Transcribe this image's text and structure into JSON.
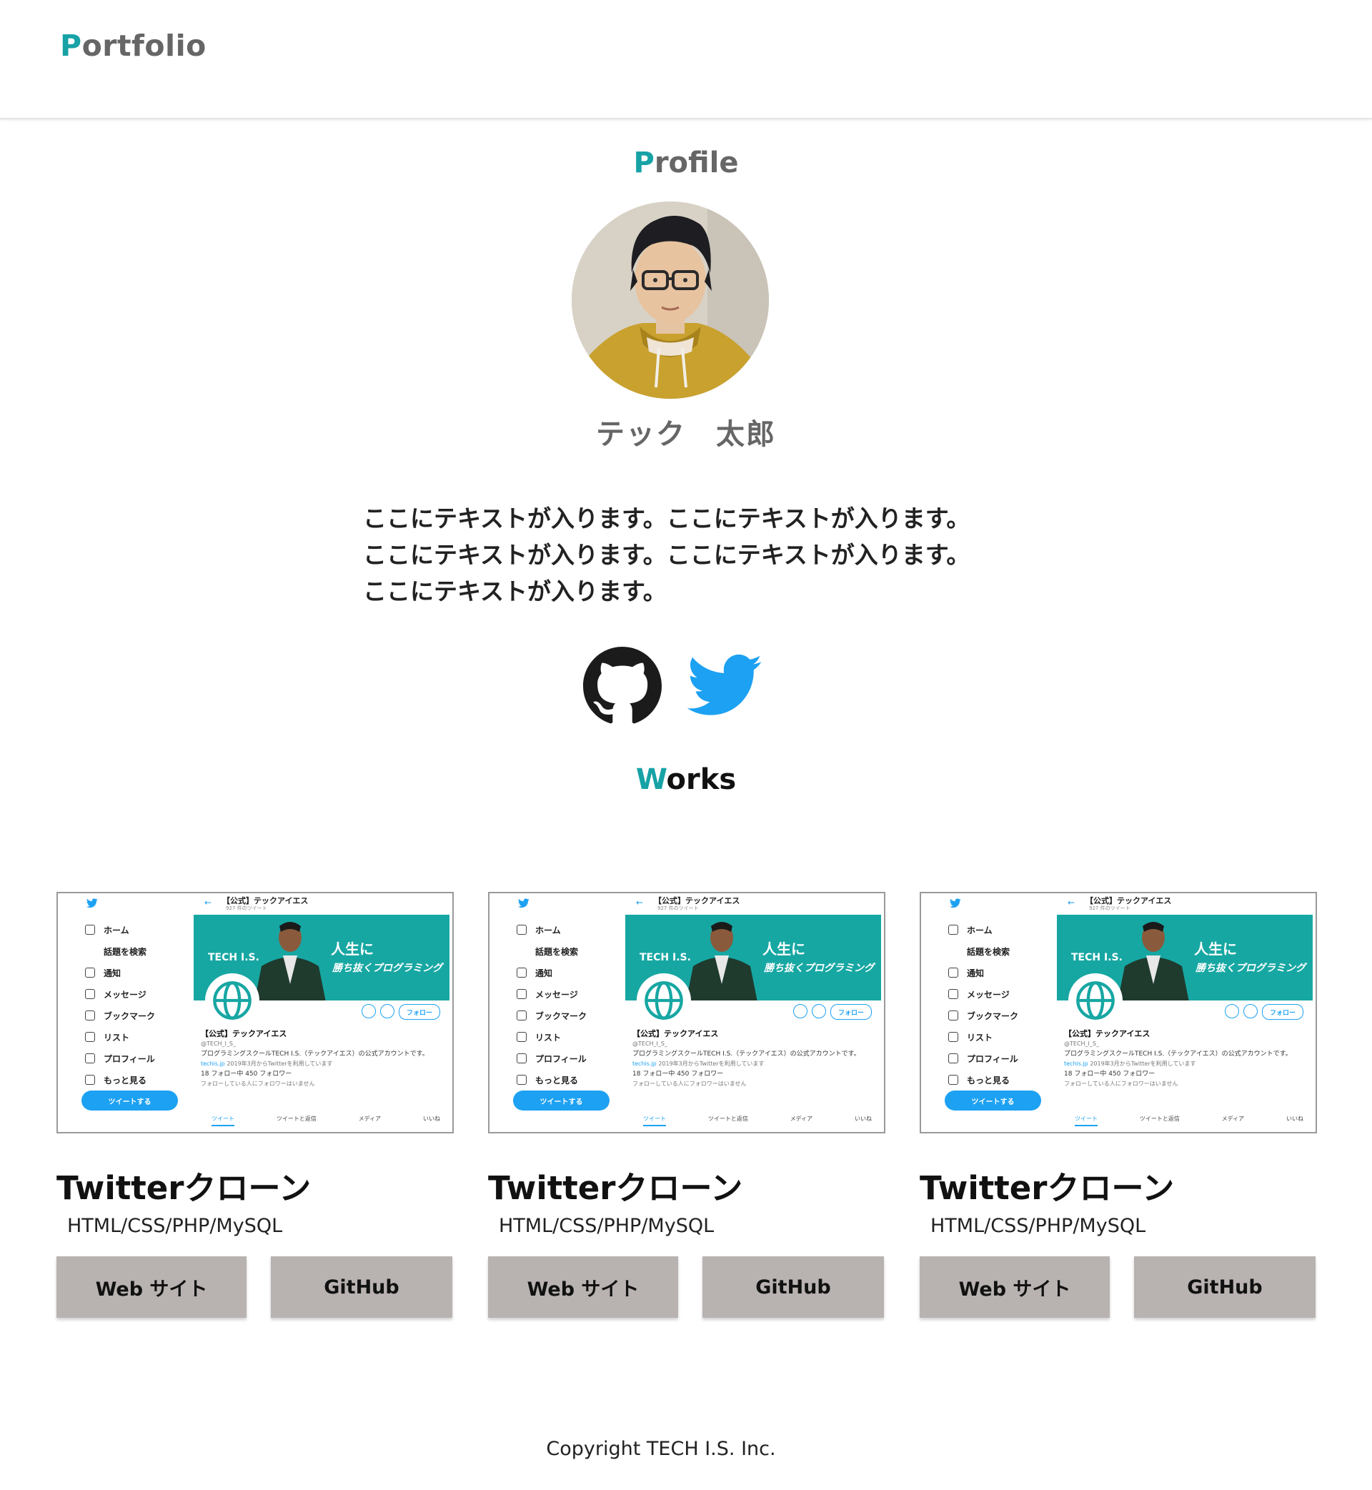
{
  "brand": {
    "logo_first": "P",
    "logo_rest": "ortfolio"
  },
  "profile": {
    "heading_first": "P",
    "heading_rest": "rofile",
    "name": "テック　太郎",
    "bio_lines": [
      "ここにテキストが入ります。ここにテキストが入ります。",
      "ここにテキストが入ります。ここにテキストが入ります。",
      "ここにテキストが入ります。"
    ],
    "social": [
      {
        "icon": "github-icon"
      },
      {
        "icon": "twitter-icon"
      }
    ]
  },
  "works": {
    "heading_first": "W",
    "heading_rest": "orks",
    "items": [
      {
        "title": "Twitterクローン",
        "tech": "HTML/CSS/PHP/MySQL",
        "site_label": "Web サイト",
        "github_label": "GitHub"
      },
      {
        "title": "Twitterクローン",
        "tech": "HTML/CSS/PHP/MySQL",
        "site_label": "Web サイト",
        "github_label": "GitHub"
      },
      {
        "title": "Twitterクローン",
        "tech": "HTML/CSS/PHP/MySQL",
        "site_label": "Web サイト",
        "github_label": "GitHub"
      }
    ]
  },
  "thumbnail": {
    "header_title": "【公式】テックアイエス",
    "header_sub": "927 件のツイート",
    "menu": [
      "ホーム",
      "話題を検索",
      "通知",
      "メッセージ",
      "ブックマーク",
      "リスト",
      "プロフィール",
      "もっと見る"
    ],
    "tweet_button": "ツイートする",
    "banner_brand": "TECH I.S.",
    "banner_line1": "人生に",
    "banner_line2": "勝ち抜くプログラミング",
    "follow_button": "フォロー",
    "account_name": "【公式】テックアイエス",
    "handle": "@TECH_I_S_",
    "description": "プログラミングスクールTECH I.S.（テックアイエス）の公式アカウントです。",
    "link": "techis.jp",
    "joined": "2019年3月からTwitterを利用しています",
    "following": "18 フォロー中",
    "followers": "450 フォロワー",
    "known": "フォローしている人にフォロワーはいません",
    "tabs": [
      "ツイート",
      "ツイートと返信",
      "メディア",
      "いいね"
    ]
  },
  "footer": {
    "copyright": "Copyright TECH I.S. Inc."
  },
  "colors": {
    "accent": "#17a2a6",
    "button": "#b8b3b1",
    "twitter": "#1da1f2",
    "banner": "#17a7a3"
  }
}
